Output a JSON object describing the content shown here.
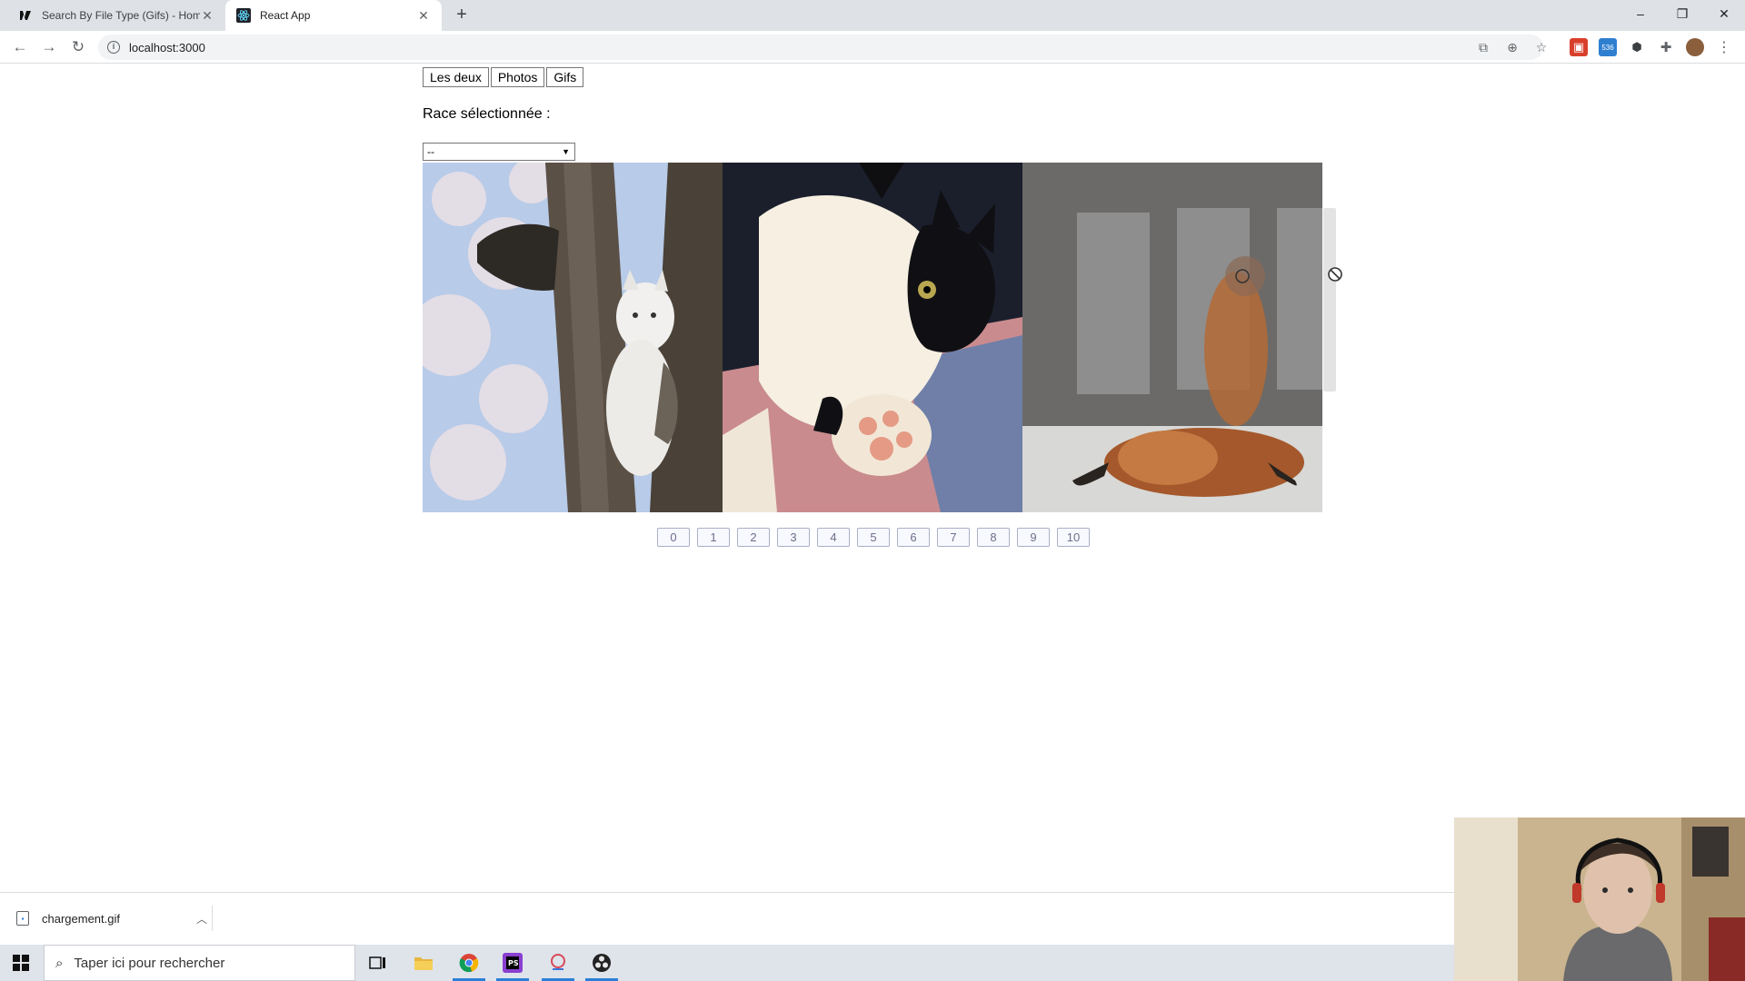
{
  "browser": {
    "tabs": [
      {
        "title": "Search By File Type (Gifs) - Home",
        "active": false,
        "favicon": "giphy-icon"
      },
      {
        "title": "React App",
        "active": true,
        "favicon": "react-icon"
      }
    ],
    "new_tab": "+",
    "address": "localhost:3000",
    "window_controls": {
      "minimize": "–",
      "restore": "❐",
      "close": "✕"
    },
    "extension_badge": "536"
  },
  "page": {
    "filter_buttons": [
      "Les deux",
      "Photos",
      "Gifs"
    ],
    "race_label": "Race sélectionnée :",
    "race_select_value": "--",
    "photos": [
      {
        "subject": "white cat on cherry blossom tree trunk"
      },
      {
        "subject": "black and white cat stretching paw"
      },
      {
        "subject": "orange long-haired cat lying on floor"
      }
    ],
    "pagination": [
      "0",
      "1",
      "2",
      "3",
      "4",
      "5",
      "6",
      "7",
      "8",
      "9",
      "10"
    ]
  },
  "downloads": {
    "file_name": "chargement.gif"
  },
  "taskbar": {
    "search_placeholder": "Taper ici pour rechercher",
    "apps": [
      "task-view-icon",
      "file-explorer-icon",
      "chrome-icon",
      "phpstorm-icon",
      "snipping-icon",
      "obs-icon"
    ]
  },
  "colors": {
    "tabstrip": "#dee1e6",
    "pager_border": "#aab0c8",
    "taskbar": "#dfe3ea"
  }
}
